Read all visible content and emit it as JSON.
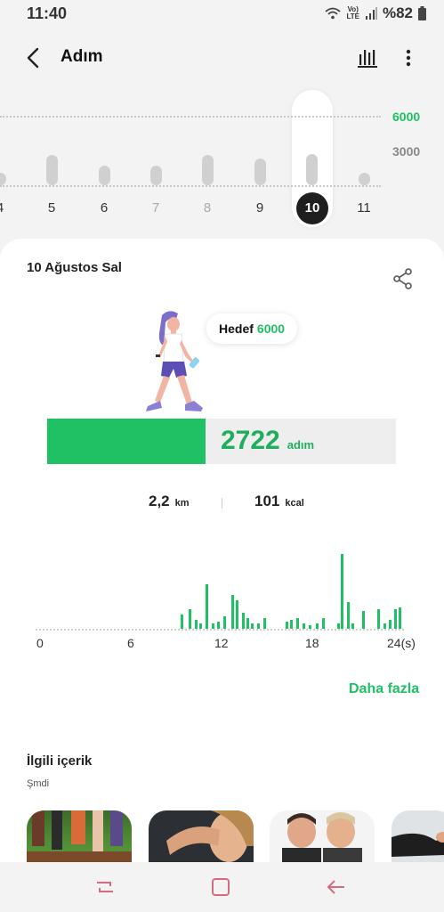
{
  "status": {
    "time": "11:40",
    "volte_top": "Vo)",
    "volte_bottom": "LTE",
    "battery": "%82"
  },
  "appbar": {
    "title": "Adım"
  },
  "week_chart": {
    "goal_label": "6000",
    "mid_label": "3000",
    "days": [
      {
        "label": "4",
        "steps": 1100
      },
      {
        "label": "5",
        "steps": 2600
      },
      {
        "label": "6",
        "steps": 1700
      },
      {
        "label": "7",
        "steps": 1700
      },
      {
        "label": "8",
        "steps": 2600
      },
      {
        "label": "9",
        "steps": 2300
      },
      {
        "label": "10",
        "steps": 2722,
        "selected": true
      },
      {
        "label": "11",
        "steps": 1100
      }
    ]
  },
  "day": {
    "date": "10 Ağustos Sal",
    "goal_label": "Hedef",
    "goal_value": "6000",
    "steps_value": "2722",
    "steps_unit": "adım",
    "progress_fraction": 0.4537,
    "distance_value": "2,2",
    "distance_unit": "km",
    "calories_value": "101",
    "calories_unit": "kcal"
  },
  "hourly_chart": {
    "x_labels": [
      "0",
      "6",
      "12",
      "18",
      "24(s)"
    ]
  },
  "links": {
    "more": "Daha fazla"
  },
  "related": {
    "title": "İlgili içerik",
    "subtitle": "Şmdi"
  },
  "colors": {
    "accent": "#20c165",
    "inactive_bar": "#d0d0d0"
  }
}
